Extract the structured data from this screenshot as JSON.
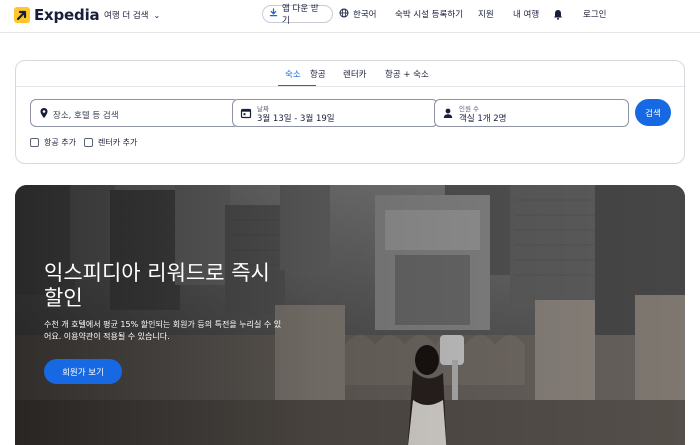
{
  "brand": {
    "name": "Expedia",
    "accent": "#1668e3",
    "logo_color": "#ffc72c"
  },
  "header": {
    "plan_trip": "여행 더 검색",
    "app_download": "앱 다운 받기",
    "language": "한국어",
    "list_property": "숙박 시설 등록하기",
    "support": "지원",
    "trips": "내 여행",
    "notifications_icon": "bell-icon",
    "login": "로그인"
  },
  "search": {
    "tabs": [
      {
        "label": "숙소",
        "active": true
      },
      {
        "label": "항공",
        "active": false
      },
      {
        "label": "렌터카",
        "active": false
      },
      {
        "label": "항공 + 숙소",
        "active": false
      }
    ],
    "destination": {
      "placeholder": "장소, 호텔 등 검색",
      "icon": "map-pin-icon"
    },
    "dates": {
      "label": "날짜",
      "value": "3월 13일 - 3월 19일",
      "icon": "calendar-icon"
    },
    "travelers": {
      "label": "인원 수",
      "value": "객실 1개 2명",
      "icon": "person-icon"
    },
    "submit": "검색",
    "add_flight": "항공 추가",
    "add_car": "렌터카 추가"
  },
  "hero": {
    "title": "익스피디아 리워드로 즉시 할인",
    "description": "수천 개 호텔에서 평균 15% 할인되는 회원가 등의 특전을 누리실 수 있어요. 이용약관이 적용될 수 있습니다.",
    "cta": "회원가 보기"
  }
}
